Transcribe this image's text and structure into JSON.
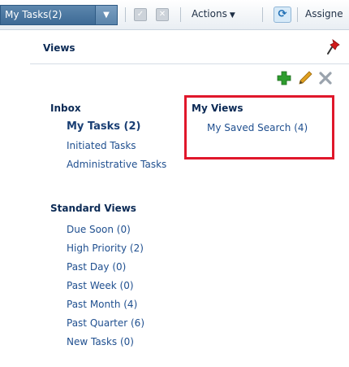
{
  "toolbar": {
    "view_select": "My Tasks(2)",
    "actions_label": "Actions",
    "assignee_label": "Assigne"
  },
  "views": {
    "title": "Views"
  },
  "inbox": {
    "heading": "Inbox",
    "items": [
      {
        "label": "My Tasks (2)",
        "active": true
      },
      {
        "label": "Initiated Tasks"
      },
      {
        "label": "Administrative Tasks"
      }
    ]
  },
  "my_views": {
    "heading": "My Views",
    "items": [
      {
        "label": "My Saved Search (4)"
      }
    ]
  },
  "standard_views": {
    "heading": "Standard Views",
    "items": [
      {
        "label": "Due Soon (0)"
      },
      {
        "label": "High Priority (2)"
      },
      {
        "label": "Past Day (0)"
      },
      {
        "label": "Past Week (0)"
      },
      {
        "label": "Past Month (4)"
      },
      {
        "label": "Past Quarter (6)"
      },
      {
        "label": "New Tasks (0)"
      }
    ]
  },
  "colors": {
    "link": "#1f4f8f",
    "heading": "#0b2a55",
    "highlight_box": "#e0172b",
    "add_icon": "#2e9c2e",
    "edit_icon": "#e0a020"
  },
  "icons": [
    "caret-down-icon",
    "checkbox-icon",
    "close-box-icon",
    "refresh-icon",
    "pin-icon",
    "add-icon",
    "edit-pencil-icon",
    "delete-x-icon"
  ]
}
